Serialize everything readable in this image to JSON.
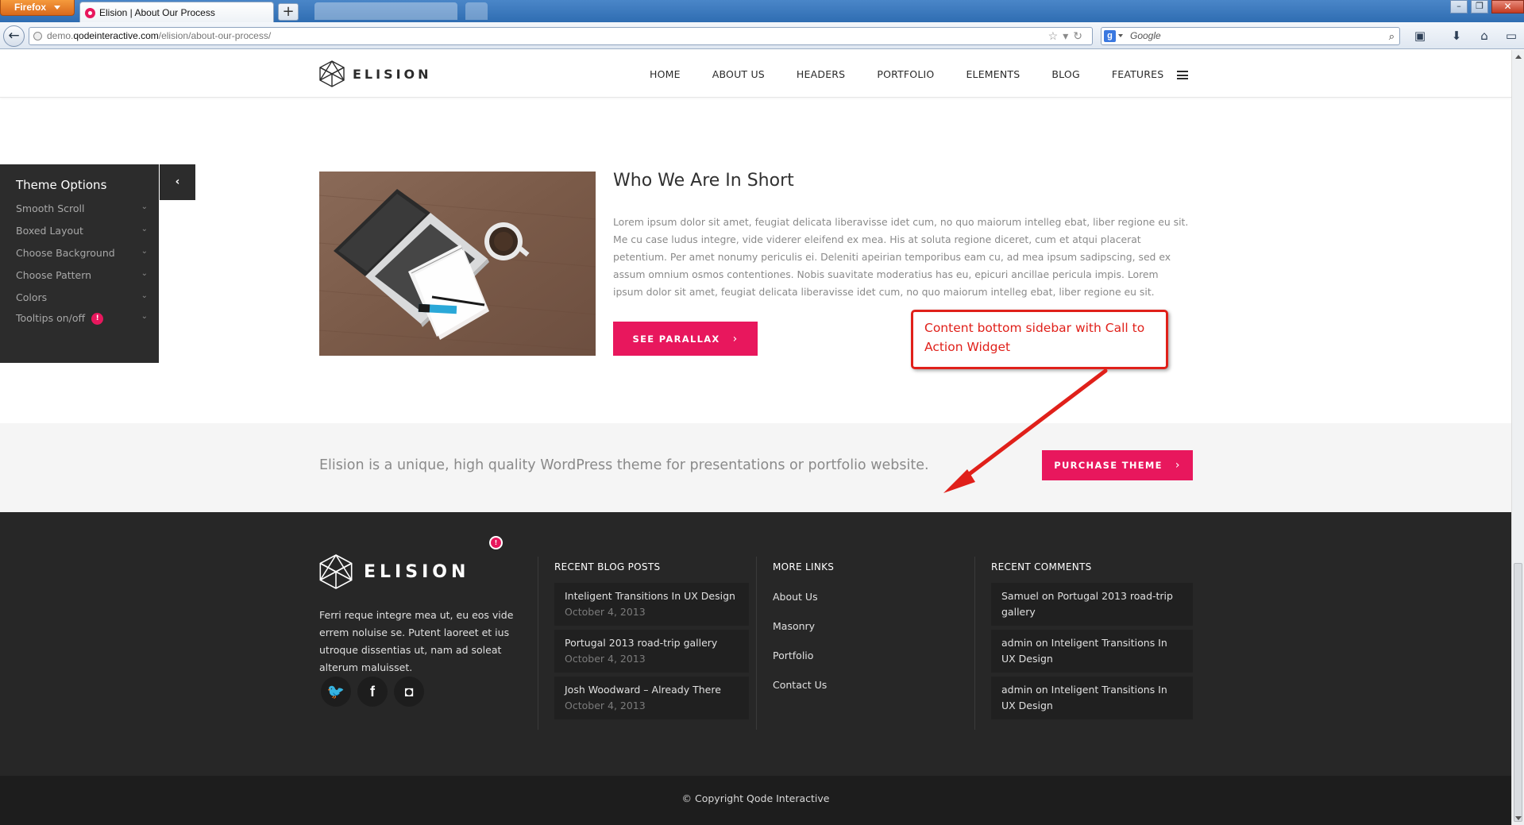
{
  "browser": {
    "app_button": "Firefox",
    "tab_title": "Elision | About Our Process",
    "new_tab": "+",
    "url_prefix": "demo.",
    "url_host": "qodeinteractive.com",
    "url_path": "/elision/about-our-process/",
    "search_placeholder": "Google",
    "search_engine_letter": "g"
  },
  "header": {
    "logo_text": "ELISION",
    "nav": [
      "HOME",
      "ABOUT US",
      "HEADERS",
      "PORTFOLIO",
      "ELEMENTS",
      "BLOG",
      "FEATURES"
    ]
  },
  "theme_options": {
    "title": "Theme Options",
    "items": [
      "Smooth Scroll",
      "Boxed Layout",
      "Choose Background",
      "Choose Pattern",
      "Colors",
      "Tooltips on/off"
    ],
    "badge": "!",
    "toggle_icon": "‹"
  },
  "section": {
    "title": "Who We Are In Short",
    "text": "Lorem ipsum dolor sit amet, feugiat delicata liberavisse idet cum, no quo maiorum intelleg ebat, liber regione eu sit. Me cu case ludus integre, vide viderer eleifend ex mea. His at soluta regione diceret, cum et atqui placerat petentium. Per amet nonumy periculis ei. Deleniti apeirian temporibus eam cu, ad mea ipsum sadipscing, sed ex assum omnium osmos contentiones. Nobis suavitate moderatius has eu, epicuri ancillae pericula impis. Lorem ipsum dolor sit amet, feugiat delicata liberavisse idet cum, no quo maiorum intelleg ebat, liber regione eu sit.",
    "button": "SEE PARALLAX",
    "button_icon": "›"
  },
  "annotation": {
    "text": "Content bottom sidebar with Call to Action Widget"
  },
  "cta": {
    "text": "Elision is a unique, high quality WordPress theme for presentations or portfolio website.",
    "button": "PURCHASE THEME",
    "button_icon": "›"
  },
  "footer": {
    "logo_text": "ELISION",
    "badge": "!",
    "description": "Ferri reque integre mea ut, eu eos vide errem noluise se. Putent laoreet et ius utroque dissentias ut, nam ad soleat alterum maluisset.",
    "social": [
      "twitter-icon",
      "facebook-icon",
      "instagram-icon"
    ],
    "social_glyphs": [
      "🐦",
      "f",
      "◘"
    ],
    "recent_posts_title": "RECENT BLOG POSTS",
    "recent_posts": [
      {
        "title": "Inteligent Transitions In UX Design",
        "date": "October 4, 2013"
      },
      {
        "title": "Portugal 2013 road-trip gallery",
        "date": "October 4, 2013"
      },
      {
        "title": "Josh Woodward – Already There",
        "date": "October 4, 2013"
      }
    ],
    "more_links_title": "MORE LINKS",
    "more_links": [
      "About Us",
      "Masonry",
      "Portfolio",
      "Contact Us"
    ],
    "recent_comments_title": "RECENT COMMENTS",
    "recent_comments": [
      "Samuel on Portugal 2013 road-trip gallery",
      "admin on Inteligent Transitions In UX Design",
      "admin on Inteligent Transitions In UX Design"
    ],
    "copyright": "© Copyright Qode Interactive"
  },
  "colors": {
    "accent": "#e8175d",
    "footer_bg": "#272727",
    "annotation": "#e0201a"
  }
}
